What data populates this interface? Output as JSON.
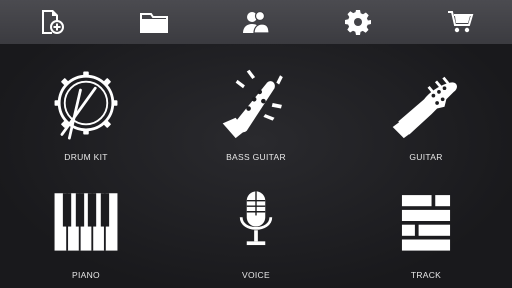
{
  "toolbar": {
    "items": [
      {
        "icon": "new-file-icon"
      },
      {
        "icon": "folder-icon"
      },
      {
        "icon": "users-icon"
      },
      {
        "icon": "gear-icon"
      },
      {
        "icon": "cart-icon"
      }
    ]
  },
  "instruments": [
    {
      "label": "DRUM KIT",
      "icon": "drum-kit-icon"
    },
    {
      "label": "BASS GUITAR",
      "icon": "bass-guitar-icon"
    },
    {
      "label": "GUITAR",
      "icon": "guitar-icon"
    },
    {
      "label": "PIANO",
      "icon": "piano-icon"
    },
    {
      "label": "VOICE",
      "icon": "microphone-icon"
    },
    {
      "label": "TRACK",
      "icon": "track-icon"
    }
  ],
  "colors": {
    "background": "#1c1c1f",
    "toolbar": "#434348",
    "icon": "#ffffff"
  }
}
